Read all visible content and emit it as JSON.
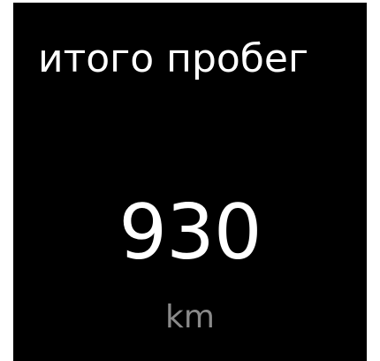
{
  "tile": {
    "title": "итого пробег",
    "value": "930",
    "unit": "km"
  },
  "colors": {
    "background": "#000000",
    "title_text": "#ffffff",
    "value_text": "#ffffff",
    "unit_text": "#8a8a8a"
  }
}
